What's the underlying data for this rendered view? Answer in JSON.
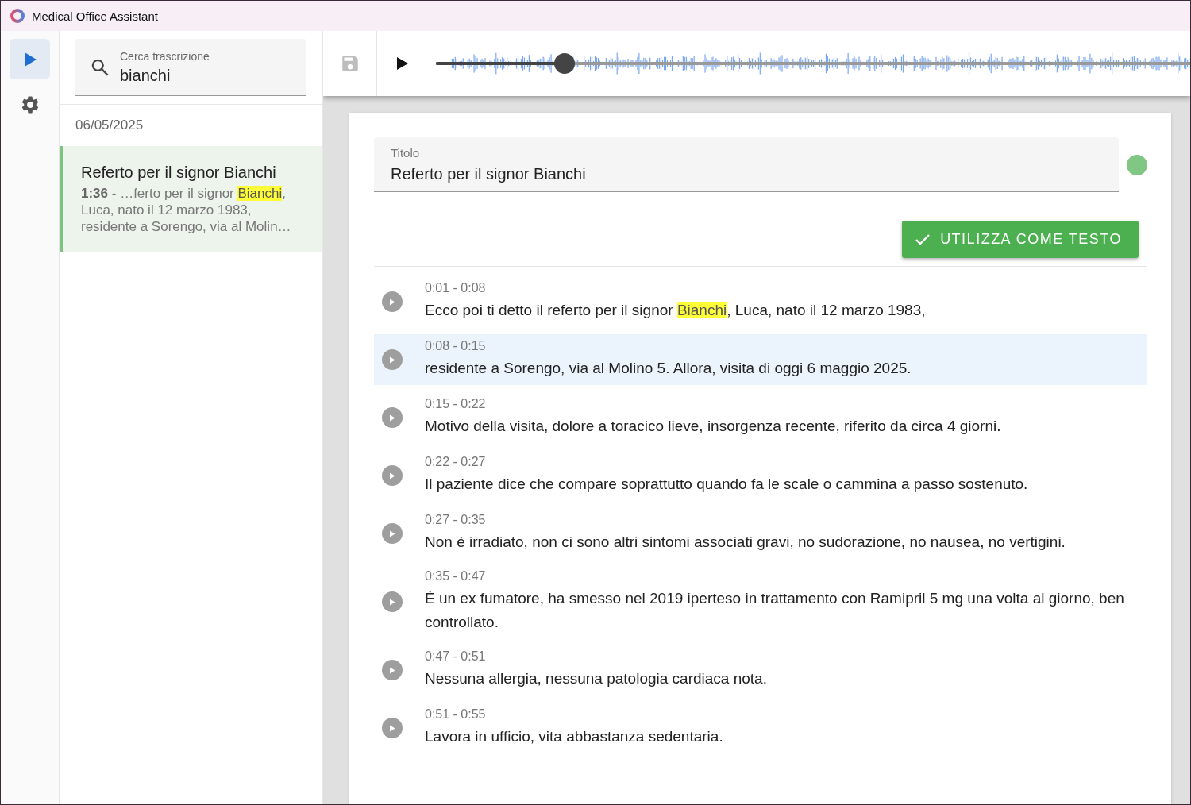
{
  "window": {
    "title": "Medical Office Assistant"
  },
  "rail": [
    {
      "kind": "play",
      "selected": true
    },
    {
      "kind": "settings",
      "selected": false
    }
  ],
  "search": {
    "label": "Cerca trascrizione",
    "value": "bianchi"
  },
  "results": [
    {
      "date": "06/05/2025",
      "items": [
        {
          "title": "Referto per il signor Bianchi",
          "selected": true,
          "snippet": [
            {
              "text": "**1:36** - …ferto per il signor ",
              "highlight": false
            },
            {
              "text": "Bianchi",
              "highlight": true
            },
            {
              "text": ", Luca, nato il 12 marzo 1983, residente a Sorengo, via al Molin…",
              "highlight": false
            }
          ]
        }
      ]
    }
  ],
  "player": {
    "save_disabled": true,
    "level": 0.17
  },
  "title_field": {
    "label": "Titolo",
    "value": "Referto per il signor Bianchi",
    "saved": true
  },
  "use_button": {
    "label": "UTILIZZA COME TESTO"
  },
  "segments": [
    {
      "time": "0:01 - 0:08",
      "selected": false,
      "parts": [
        {
          "text": "Ecco poi ti detto il referto per il signor ",
          "highlight": false
        },
        {
          "text": "Bianchi",
          "highlight": true
        },
        {
          "text": ", Luca, nato il 12 marzo 1983,",
          "highlight": false
        }
      ]
    },
    {
      "time": "0:08 - 0:15",
      "selected": true,
      "parts": [
        {
          "text": "residente a Sorengo, via al Molino 5. Allora, visita di oggi 6 maggio 2025.",
          "highlight": false
        }
      ]
    },
    {
      "time": "0:15 - 0:22",
      "selected": false,
      "parts": [
        {
          "text": "Motivo della visita, dolore a toracico lieve, insorgenza recente, riferito da circa 4 giorni.",
          "highlight": false
        }
      ]
    },
    {
      "time": "0:22 - 0:27",
      "selected": false,
      "parts": [
        {
          "text": "Il paziente dice che compare soprattutto quando fa le scale o cammina a passo sostenuto.",
          "highlight": false
        }
      ]
    },
    {
      "time": "0:27 - 0:35",
      "selected": false,
      "parts": [
        {
          "text": "Non è irradiato, non ci sono altri sintomi associati gravi, no sudorazione, no nausea, no vertigini.",
          "highlight": false
        }
      ]
    },
    {
      "time": "0:35 - 0:47",
      "selected": false,
      "parts": [
        {
          "text": "È un ex fumatore, ha smesso nel 2019 iperteso in trattamento con Ramipril 5 mg una volta al giorno, ben controllato.",
          "highlight": false
        }
      ]
    },
    {
      "time": "0:47 - 0:51",
      "selected": false,
      "parts": [
        {
          "text": "Nessuna allergia, nessuna patologia cardiaca nota.",
          "highlight": false
        }
      ]
    },
    {
      "time": "0:51 - 0:55",
      "selected": false,
      "parts": [
        {
          "text": "Lavora in ufficio, vita abbastanza sedentaria.",
          "highlight": false
        }
      ]
    }
  ]
}
